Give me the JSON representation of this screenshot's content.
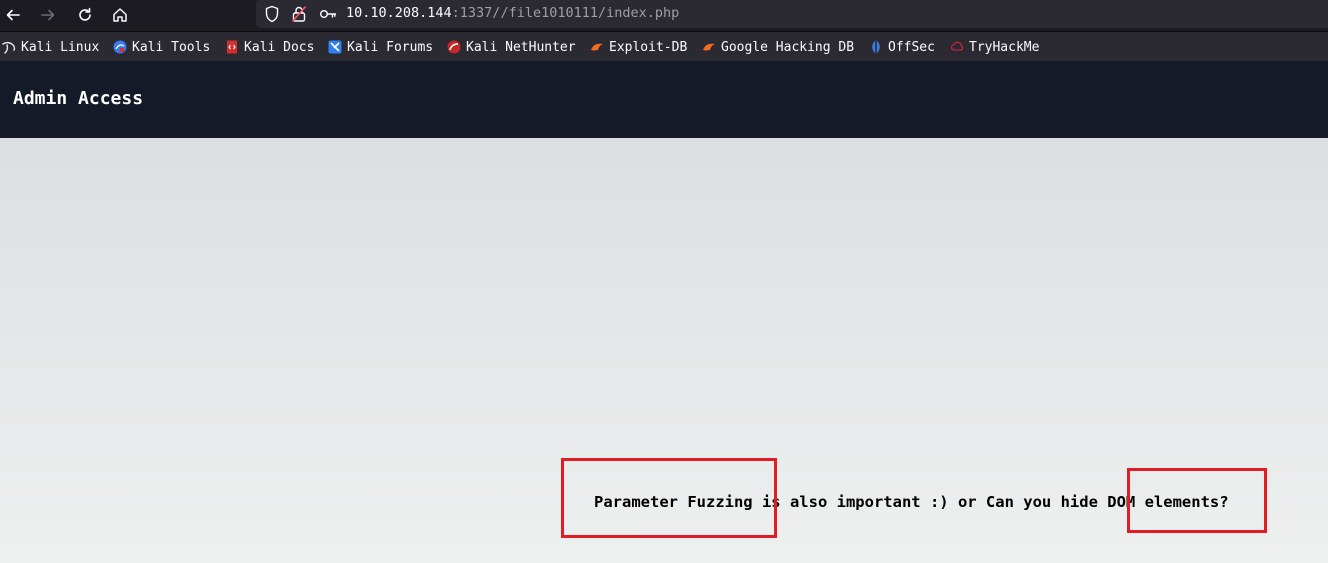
{
  "browser": {
    "url_host": "10.10.208.144",
    "url_rest": ":1337//file1010111/index.php",
    "bookmarks": [
      {
        "label": "Kali Linux",
        "icon": "kali-dragon-icon"
      },
      {
        "label": "Kali Tools",
        "icon": "kali-tools-icon"
      },
      {
        "label": "Kali Docs",
        "icon": "kali-docs-icon"
      },
      {
        "label": "Kali Forums",
        "icon": "kali-forums-icon"
      },
      {
        "label": "Kali NetHunter",
        "icon": "kali-nethunter-icon"
      },
      {
        "label": "Exploit-DB",
        "icon": "exploit-db-icon"
      },
      {
        "label": "Google Hacking DB",
        "icon": "ghdb-icon"
      },
      {
        "label": "OffSec",
        "icon": "offsec-icon"
      },
      {
        "label": "TryHackMe",
        "icon": "tryhackme-icon"
      }
    ]
  },
  "page": {
    "title": "Admin Access",
    "message": "Parameter Fuzzing is also important :) or Can you hide DOM elements?"
  },
  "colors": {
    "header_bg": "#141a28",
    "highlight_box": "#e31b23"
  }
}
